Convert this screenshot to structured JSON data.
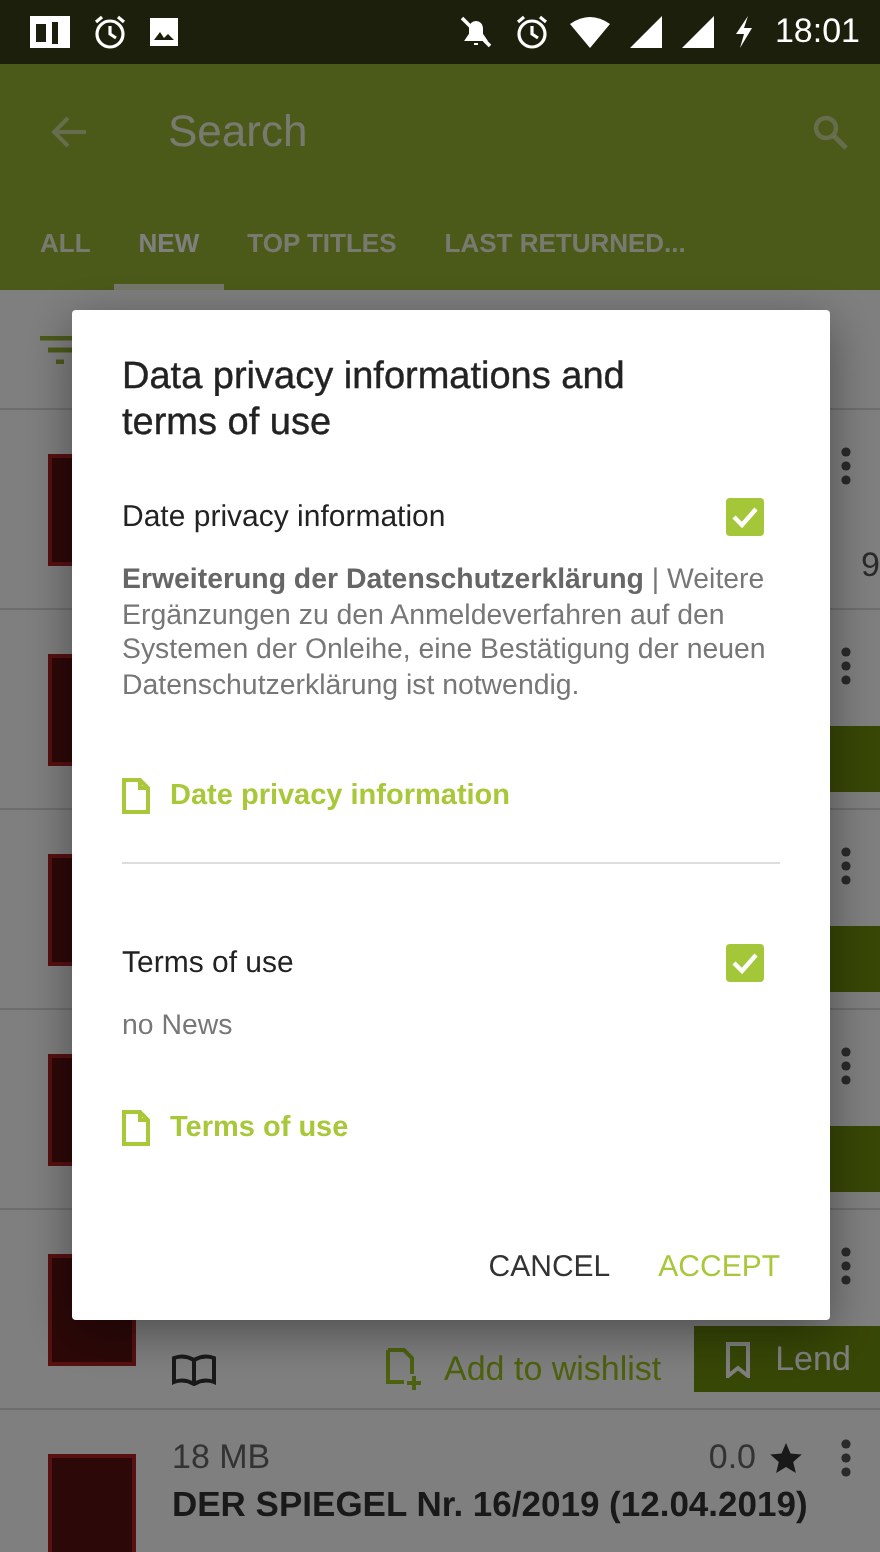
{
  "status_bar": {
    "time": "18:01"
  },
  "app_bar": {
    "title": "Search"
  },
  "tabs": [
    {
      "label": "ALL",
      "selected": false
    },
    {
      "label": "NEW",
      "selected": true
    },
    {
      "label": "TOP TITLES",
      "selected": false
    },
    {
      "label": "LAST RETURNED...",
      "selected": false
    }
  ],
  "list": {
    "items": [
      {
        "kind": "peek_text",
        "fragment": "9"
      },
      {
        "kind": "peek_button"
      },
      {
        "kind": "peek_button"
      },
      {
        "kind": "peek_button"
      },
      {
        "kind": "actions",
        "wishlist": "Add to wishlist",
        "lend": "Lend"
      },
      {
        "kind": "details",
        "size": "18 MB",
        "rating": "0.0",
        "title": "DER SPIEGEL Nr. 16/2019 (12.04.2019)"
      }
    ]
  },
  "dialog": {
    "title": "Data privacy informations and terms of use",
    "sections": [
      {
        "label": "Date privacy information",
        "checked": true,
        "description": "**Erweiterung der Datenschutzerklärung** |  Weitere Ergänzungen zu den Anmeldeverfahren auf den Systemen der Onleihe, eine Bestätigung der neuen Datenschutzerklärung ist notwendig.",
        "link": "Date privacy information"
      },
      {
        "label": "Terms of use",
        "checked": true,
        "description": "no News",
        "link": "Terms of use"
      }
    ],
    "buttons": [
      {
        "label": "CANCEL",
        "kind": "cancel"
      },
      {
        "label": "ACCEPT",
        "kind": "accept"
      }
    ]
  }
}
